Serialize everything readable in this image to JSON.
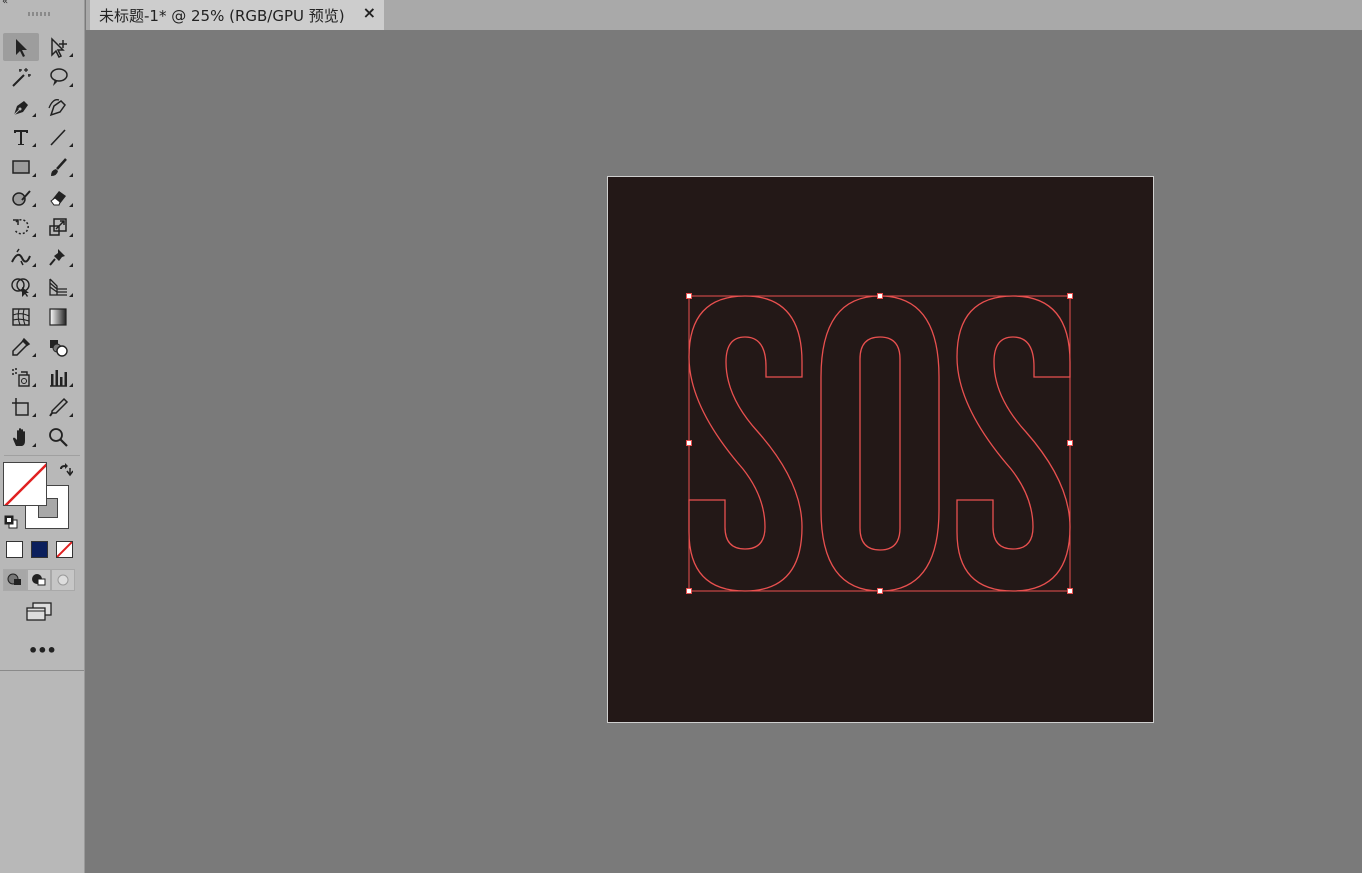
{
  "tabs": [
    {
      "title": "未标题-1* @ 25% (RGB/GPU 预览)",
      "close_symbol": "×"
    }
  ],
  "toolbar": {
    "collapse_symbol": "«",
    "tools": [
      "selection-tool",
      "direct-selection-tool",
      "magic-wand-tool",
      "lasso-tool",
      "pen-tool",
      "curvature-tool",
      "type-tool",
      "line-segment-tool",
      "rectangle-tool",
      "paintbrush-tool",
      "shaper-tool",
      "eraser-tool",
      "rotate-tool",
      "scale-tool",
      "width-tool",
      "puppet-warp-tool",
      "shape-builder-tool",
      "perspective-grid-tool",
      "mesh-tool",
      "gradient-tool",
      "eyedropper-tool",
      "blend-tool",
      "symbol-sprayer-tool",
      "column-graph-tool",
      "artboard-tool",
      "slice-tool",
      "hand-tool",
      "zoom-tool"
    ],
    "more_label": "•••"
  },
  "colors": {
    "fill": "none",
    "stroke": "none",
    "artboard_bg": "#231817",
    "outline_stroke": "#e8504f",
    "workspace_bg": "#7a7a7a",
    "swatch_navy": "#0b1f5c"
  },
  "artwork": {
    "text": "SOS",
    "state": "outlined-selected"
  }
}
